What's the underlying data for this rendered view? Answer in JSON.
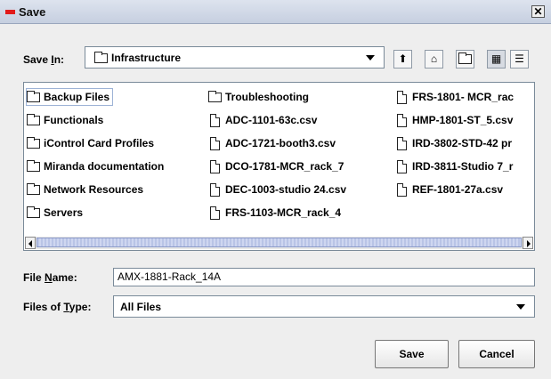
{
  "title": "Save",
  "close_glyph": "✕",
  "save_in": {
    "label_prefix": "Save ",
    "label_mnemonic": "I",
    "label_suffix": "n:",
    "value": "Infrastructure"
  },
  "toolbar": [
    {
      "name": "up-one-level-icon",
      "glyph": "⬆"
    },
    {
      "name": "home-icon",
      "glyph": "⌂"
    },
    {
      "name": "new-folder-icon",
      "glyph": ""
    },
    {
      "name": "list-view-icon",
      "glyph": "▦"
    },
    {
      "name": "details-view-icon",
      "glyph": "☰"
    }
  ],
  "files": {
    "col1": [
      "Backup Files",
      "Functionals",
      "iControl Card Profiles",
      "Miranda documentation",
      "Network Resources",
      "Servers"
    ],
    "col2_folder": "Troubleshooting",
    "col2_files": [
      "ADC-1101-63c.csv",
      "ADC-1721-booth3.csv",
      "DCO-1781-MCR_rack_7",
      "DEC-1003-studio 24.csv",
      "FRS-1103-MCR_rack_4"
    ],
    "col3_files": [
      "FRS-1801- MCR_rac",
      "HMP-1801-ST_5.csv",
      "IRD-3802-STD-42 pr",
      "IRD-3811-Studio 7_r",
      "REF-1801-27a.csv"
    ]
  },
  "file_name": {
    "label_prefix": "File ",
    "label_mnemonic": "N",
    "label_suffix": "ame:",
    "value": "AMX-1881-Rack_14A"
  },
  "file_type": {
    "label_prefix": "Files of ",
    "label_mnemonic": "T",
    "label_suffix": "ype:",
    "value": "All Files"
  },
  "buttons": {
    "save": "Save",
    "cancel": "Cancel"
  }
}
